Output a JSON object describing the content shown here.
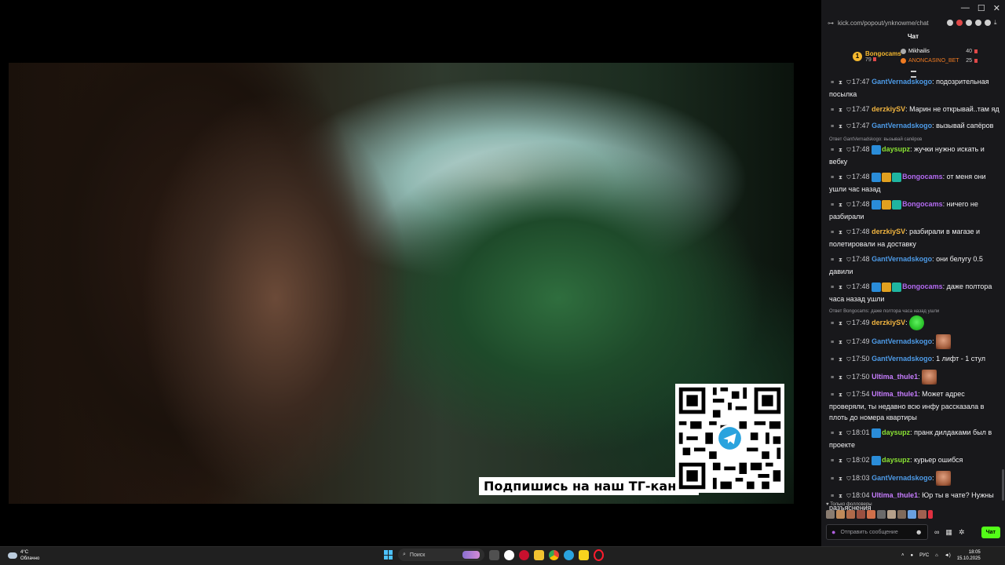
{
  "video": {
    "caption": "Подпишись на наш ТГ-канал"
  },
  "browser": {
    "url": "kick.com/popout/ynknowme/chat"
  },
  "chat": {
    "title": "Чат",
    "leaderboard": [
      {
        "rank": "1",
        "name": "Bongocams",
        "points": "79"
      },
      {
        "name": "Mikhailis",
        "points": "40"
      },
      {
        "name": "ANONCASINO_BET",
        "points": "25"
      }
    ],
    "messages": [
      {
        "time": "17:47",
        "user": "GantVernadskogo",
        "color": "#4d9be8",
        "text": "подозрительная посылка",
        "reply": "",
        "emotes": ""
      },
      {
        "time": "17:47",
        "user": "derzkiySV",
        "color": "#f0b440",
        "text": "Марин не открывай..там яд",
        "reply": "",
        "emotes": ""
      },
      {
        "time": "17:47",
        "user": "GantVernadskogo",
        "color": "#4d9be8",
        "text": "вызывай сапёров",
        "reply": "",
        "emotes": ""
      },
      {
        "time": "17:48",
        "user": "daysupz",
        "color": "#8ae234",
        "text": "жучки нужно искать и вебку",
        "reply": "Ответ GantVernadskogo: вызывай сапёров",
        "emotes": "1"
      },
      {
        "time": "17:48",
        "user": "Bongocams",
        "color": "#b46bf2",
        "text": "от меня они ушли час назад",
        "reply": "",
        "emotes": "3"
      },
      {
        "time": "17:48",
        "user": "Bongocams",
        "color": "#b46bf2",
        "text": "ничего не разбирали",
        "reply": "",
        "emotes": "3"
      },
      {
        "time": "17:48",
        "user": "derzkiySV",
        "color": "#f0b440",
        "text": "разбирали в магазе и полетировали на доставку",
        "reply": "",
        "emotes": ""
      },
      {
        "time": "17:48",
        "user": "GantVernadskogo",
        "color": "#4d9be8",
        "text": "они белугу 0.5 давили",
        "reply": "",
        "emotes": ""
      },
      {
        "time": "17:48",
        "user": "Bongocams",
        "color": "#b46bf2",
        "text": "даже полтора часа назад ушли",
        "reply": "",
        "emotes": "3"
      },
      {
        "time": "17:49",
        "user": "derzkiySV",
        "color": "#f0b440",
        "text": "",
        "reply": "Ответ Bongocams: даже полтора часа назад ушли",
        "emotes": "",
        "emote_after": "green-blob"
      },
      {
        "time": "17:49",
        "user": "GantVernadskogo",
        "color": "#4d9be8",
        "text": "",
        "reply": "",
        "emotes": "",
        "emote_after": "face"
      },
      {
        "time": "17:50",
        "user": "GantVernadskogo",
        "color": "#4d9be8",
        "text": "1 лифт - 1 стул",
        "reply": "",
        "emotes": ""
      },
      {
        "time": "17:50",
        "user": "Ultima_thule1",
        "color": "#c77dff",
        "text": "",
        "reply": "",
        "emotes": "",
        "emote_after": "face"
      },
      {
        "time": "17:54",
        "user": "Ultima_thule1",
        "color": "#c77dff",
        "text": "Может адрес проверяли, ты недавно всю инфу рассказала в плоть до номера квартиры",
        "reply": "",
        "emotes": ""
      },
      {
        "time": "18:01",
        "user": "daysupz",
        "color": "#8ae234",
        "text": "пранк дилдаками был в проекте",
        "reply": "",
        "emotes": "1"
      },
      {
        "time": "18:02",
        "user": "daysupz",
        "color": "#8ae234",
        "text": "курьер ошибся",
        "reply": "",
        "emotes": "1"
      },
      {
        "time": "18:03",
        "user": "GantVernadskogo",
        "color": "#4d9be8",
        "text": "",
        "reply": "",
        "emotes": "",
        "emote_after": "face"
      },
      {
        "time": "18:04",
        "user": "Ultima_thule1",
        "color": "#c77dff",
        "text": "Юр ты в чате? Нужны разъяснения",
        "reply": "",
        "emotes": ""
      }
    ],
    "followers_only": "Только фолловеры",
    "input_placeholder": "Отправить сообщение",
    "send_label": "Чат"
  },
  "taskbar": {
    "temperature": "4°C",
    "weather": "Облачно",
    "search_placeholder": "Поиск",
    "language": "РУС",
    "time": "18:05",
    "date": "15.10.2025"
  }
}
